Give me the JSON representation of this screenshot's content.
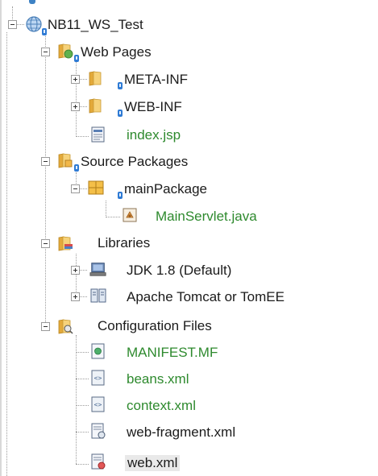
{
  "tree": {
    "project": {
      "label": "NB11_WS_Test",
      "icon": "web-project-globe-icon"
    },
    "web_pages": {
      "label": "Web Pages",
      "children": [
        {
          "label": "META-INF",
          "icon": "folder-icon"
        },
        {
          "label": "WEB-INF",
          "icon": "folder-icon"
        },
        {
          "label": "index.jsp",
          "icon": "jsp-file-icon"
        }
      ]
    },
    "source_packages": {
      "label": "Source Packages",
      "package": {
        "label": "mainPackage",
        "icon": "package-icon"
      },
      "file": {
        "label": "MainServlet.java",
        "icon": "java-class-icon"
      }
    },
    "libraries": {
      "label": "Libraries",
      "children": [
        {
          "label": "JDK 1.8 (Default)",
          "icon": "jdk-icon"
        },
        {
          "label": "Apache Tomcat or TomEE",
          "icon": "server-library-icon"
        }
      ]
    },
    "config_files": {
      "label": "Configuration Files",
      "children": [
        {
          "label": "MANIFEST.MF",
          "icon": "manifest-icon"
        },
        {
          "label": "beans.xml",
          "icon": "xml-file-icon"
        },
        {
          "label": "context.xml",
          "icon": "xml-file-icon"
        },
        {
          "label": "web-fragment.xml",
          "icon": "web-fragment-icon"
        },
        {
          "label": "web.xml",
          "icon": "web-xml-icon"
        }
      ]
    }
  },
  "colors": {
    "file_text": "#2e8a2e",
    "folder": "#f0c248",
    "badge": "#2f7bd4",
    "selection": "#e9e9e9"
  }
}
